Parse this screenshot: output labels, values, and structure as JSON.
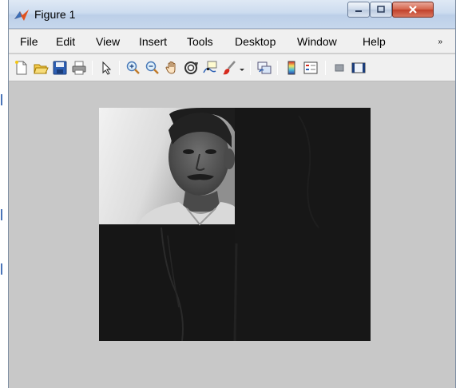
{
  "window": {
    "title": "Figure 1",
    "controls": {
      "minimize": "minimize",
      "maximize": "maximize",
      "close": "close"
    }
  },
  "menubar": {
    "items": [
      {
        "label": "File"
      },
      {
        "label": "Edit"
      },
      {
        "label": "View"
      },
      {
        "label": "Insert"
      },
      {
        "label": "Tools"
      },
      {
        "label": "Desktop"
      },
      {
        "label": "Window"
      },
      {
        "label": "Help"
      }
    ],
    "overflow": "»"
  },
  "toolbar": {
    "buttons": [
      "new-figure-icon",
      "open-file-icon",
      "save-icon",
      "print-icon",
      "pointer-icon",
      "zoom-in-icon",
      "zoom-out-icon",
      "pan-hand-icon",
      "rotate-3d-icon",
      "data-cursor-icon",
      "brush-icon",
      "link-plot-icon",
      "colorbar-icon",
      "legend-icon",
      "hide-plot-tools-icon",
      "show-plot-tools-icon"
    ]
  },
  "colors": {
    "window_bg": "#c8c8c8",
    "axes_bg": "#161616",
    "close_button": "#c1402a"
  },
  "figure": {
    "image": "grayscale image: top-left quadrant shows a man's face, remaining quadrants dark"
  }
}
